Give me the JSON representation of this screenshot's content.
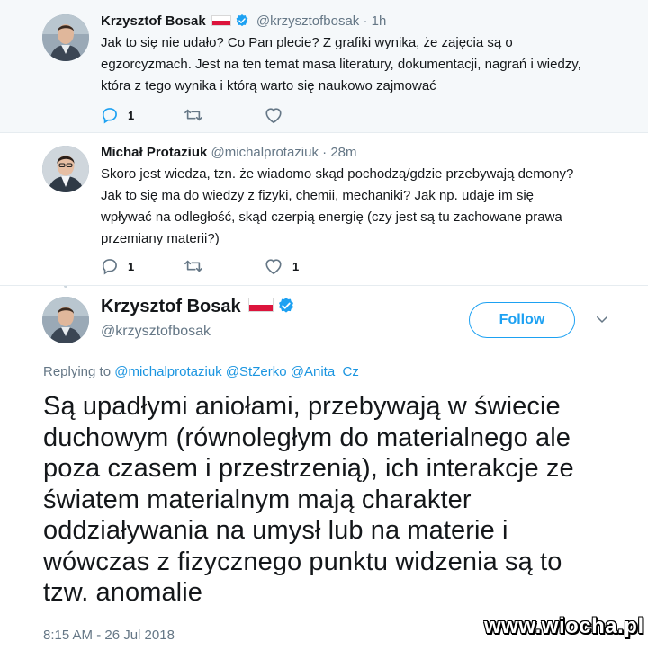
{
  "colors": {
    "accent": "#1da1f2",
    "link": "#1b95e0",
    "muted": "#657786",
    "text": "#14171a",
    "flag_red": "#dc143c"
  },
  "thread": [
    {
      "name": "Krzysztof Bosak",
      "handle": "@krzysztofbosak",
      "time": "1h",
      "verified": true,
      "flag": "poland-flag",
      "text_lines": [
        "Jak to się nie udało? Co Pan plecie? Z grafiki wynika, że zajęcia są o",
        "egzorcyzmach. Jest na ten temat masa literatury, dokumentacji, nagrań i wiedzy,",
        "która z tego wynika i którą warto się naukowo zajmować"
      ],
      "reply_count": "1",
      "retweet_count": "",
      "like_count": ""
    },
    {
      "name": "Michał Protaziuk",
      "handle": "@michalprotaziuk",
      "time": "28m",
      "verified": false,
      "text_lines": [
        "Skoro jest wiedza, tzn. że wiadomo skąd pochodzą/gdzie przebywają demony?",
        "Jak to się ma do wiedzy z fizyki, chemii, mechaniki? Jak np. udaje im się",
        "wpływać na odległość, skąd czerpią energię (czy jest są tu zachowane prawa",
        "przemiany materii?)"
      ],
      "reply_count": "1",
      "retweet_count": "",
      "like_count": "1"
    }
  ],
  "main_tweet": {
    "name": "Krzysztof Bosak",
    "handle": "@krzysztofbosak",
    "follow_label": "Follow",
    "replying_label": "Replying to",
    "mentions": [
      "@michalprotaziuk",
      "@StZerko",
      "@Anita_Cz"
    ],
    "text_lines": [
      "Są upadłymi aniołami, przebywają w świecie",
      "duchowym (równoległym do materialnego ale",
      "poza czasem i przestrzenią), ich interakcje ze",
      "światem materialnym mają charakter",
      "oddziaływania na umysł lub na materie i",
      "wówczas z fizycznego punktu widzenia są to",
      "tzw. anomalie"
    ],
    "timestamp": "8:15 AM - 26 Jul 2018"
  },
  "watermark": "www.wiocha.pl",
  "separator": "·"
}
